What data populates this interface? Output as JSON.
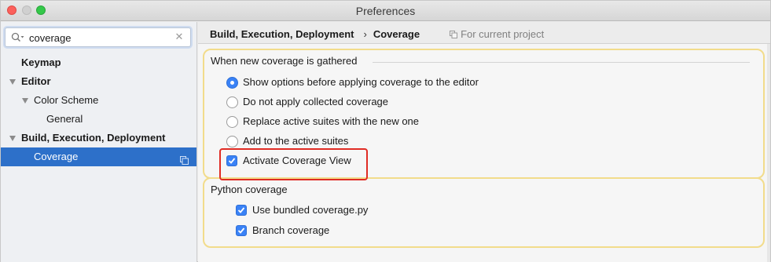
{
  "window": {
    "title": "Preferences"
  },
  "search": {
    "value": "coverage"
  },
  "sidebar": {
    "items": [
      {
        "label": "Keymap"
      },
      {
        "label": "Editor"
      },
      {
        "label": "Color Scheme"
      },
      {
        "label": "General"
      },
      {
        "label": "Build, Execution, Deployment"
      },
      {
        "label": "Coverage"
      }
    ]
  },
  "breadcrumb": {
    "parent": "Build, Execution, Deployment",
    "separator": "›",
    "current": "Coverage",
    "scope_note": "For current project"
  },
  "coverage_group": {
    "title": "When new coverage is gathered",
    "options": [
      {
        "label": "Show options before applying coverage to the editor",
        "selected": true
      },
      {
        "label": "Do not apply collected coverage",
        "selected": false
      },
      {
        "label": "Replace active suites with the new one",
        "selected": false
      },
      {
        "label": "Add to the active suites",
        "selected": false
      }
    ],
    "activate_view": {
      "label": "Activate Coverage View",
      "checked": true
    }
  },
  "python_group": {
    "title": "Python coverage",
    "options": [
      {
        "label": "Use bundled coverage.py",
        "checked": true
      },
      {
        "label": "Branch coverage",
        "checked": true
      }
    ]
  },
  "colors": {
    "selection": "#2d70c9",
    "accent": "#3a82f6",
    "group_border": "#f2dc8b",
    "highlight": "#e02c24"
  }
}
